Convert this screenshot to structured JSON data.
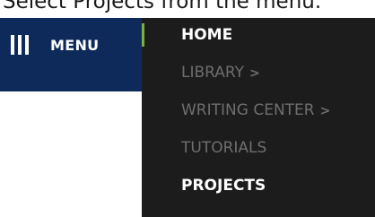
{
  "instruction": "Select Projects from the menu.",
  "menu_button": {
    "label": "MENU"
  },
  "nav": {
    "accent_color": "#79b23a",
    "items": [
      {
        "label": "HOME",
        "state": "active",
        "submenu": false
      },
      {
        "label": "LIBRARY",
        "state": "dim",
        "submenu": true,
        "caret": ">"
      },
      {
        "label": "WRITING CENTER",
        "state": "dim",
        "submenu": true,
        "caret": ">"
      },
      {
        "label": "TUTORIALS",
        "state": "dim",
        "submenu": false
      },
      {
        "label": "PROJECTS",
        "state": "active",
        "submenu": false
      }
    ]
  },
  "colors": {
    "menu_bar": "#0e2a5a",
    "panel": "#1c1c1c",
    "active_text": "#ffffff",
    "dim_text": "#6e6e6e"
  }
}
